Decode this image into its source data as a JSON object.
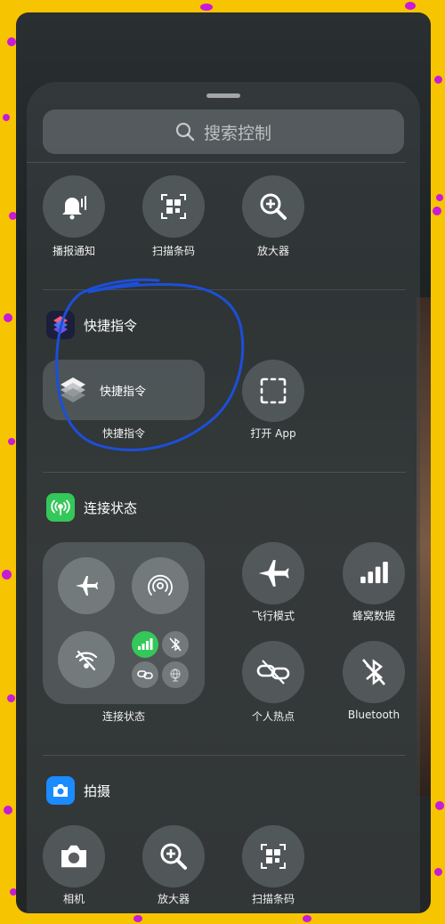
{
  "search": {
    "placeholder": "搜索控制"
  },
  "row1": [
    {
      "label": "播报通知",
      "icon": "announce-notifications-icon"
    },
    {
      "label": "扫描条码",
      "icon": "qr-code-icon"
    },
    {
      "label": "放大器",
      "icon": "magnifier-icon"
    }
  ],
  "shortcuts": {
    "section_title": "快捷指令",
    "wide_tile_label": "快捷指令",
    "wide_caption": "快捷指令",
    "open_app_label": "打开 App"
  },
  "connectivity": {
    "section_title": "连接状态",
    "group_caption": "连接状态",
    "airplane_label": "飞行模式",
    "cellular_label": "蜂窝数据",
    "hotspot_label": "个人热点",
    "bluetooth_label": "Bluetooth"
  },
  "camera": {
    "section_title": "拍摄",
    "items": [
      {
        "label": "相机",
        "icon": "camera-icon"
      },
      {
        "label": "放大器",
        "icon": "magnifier-icon"
      },
      {
        "label": "扫描条码",
        "icon": "qr-code-icon"
      }
    ]
  },
  "colors": {
    "border_yellow": "#f6c400",
    "dot_magenta": "#c81ad9",
    "annotation_blue": "#1c4fd8",
    "connectivity_green": "#34c759",
    "camera_blue": "#1a8cff"
  }
}
